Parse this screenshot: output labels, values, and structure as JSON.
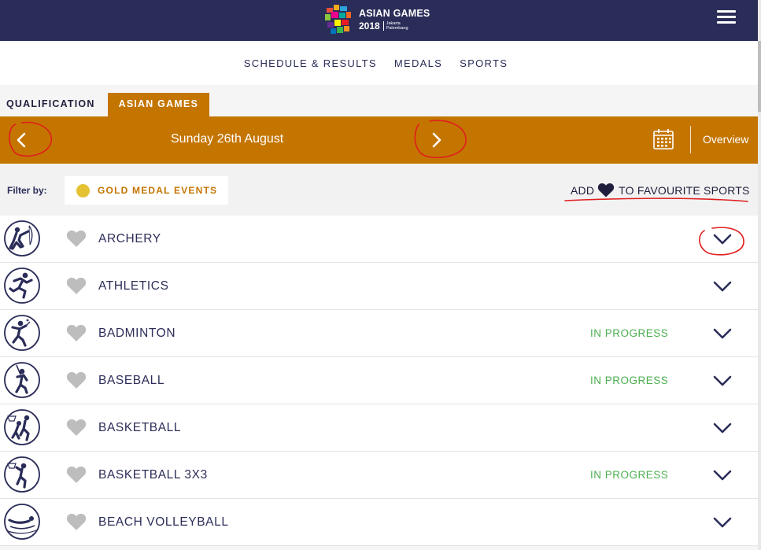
{
  "header": {
    "logo_title": "ASIAN GAMES",
    "logo_year": "2018",
    "logo_city1": "Jakarta",
    "logo_city2": "Palembang",
    "menu_icon": "hamburger-icon"
  },
  "nav": {
    "items": [
      {
        "label": "SCHEDULE & RESULTS"
      },
      {
        "label": "MEDALS"
      },
      {
        "label": "SPORTS"
      }
    ]
  },
  "tabs": [
    {
      "label": "QUALIFICATION",
      "active": false
    },
    {
      "label": "ASIAN GAMES",
      "active": true
    }
  ],
  "datebar": {
    "date": "Sunday 26th August",
    "overview": "Overview",
    "prev_icon": "chevron-left-icon",
    "next_icon": "chevron-right-icon",
    "calendar_icon": "calendar-icon"
  },
  "filter": {
    "label": "Filter by:",
    "gold_label": "GOLD MEDAL EVENTS",
    "fav_prefix": "ADD",
    "fav_suffix": "TO FAVOURITE SPORTS"
  },
  "sports": [
    {
      "name": "ARCHERY",
      "status": "",
      "icon": "archery-icon"
    },
    {
      "name": "ATHLETICS",
      "status": "",
      "icon": "athletics-icon"
    },
    {
      "name": "BADMINTON",
      "status": "IN PROGRESS",
      "icon": "badminton-icon"
    },
    {
      "name": "BASEBALL",
      "status": "IN PROGRESS",
      "icon": "baseball-icon"
    },
    {
      "name": "BASKETBALL",
      "status": "",
      "icon": "basketball-icon"
    },
    {
      "name": "BASKETBALL 3X3",
      "status": "IN PROGRESS",
      "icon": "basketball-3x3-icon"
    },
    {
      "name": "BEACH VOLLEYBALL",
      "status": "",
      "icon": "beach-volleyball-icon"
    }
  ],
  "colors": {
    "header_bg": "#2b2d59",
    "accent_orange": "#c47500",
    "status_green": "#4caf50",
    "gold": "#e5c232",
    "annotation_red": "#e01e1e"
  }
}
